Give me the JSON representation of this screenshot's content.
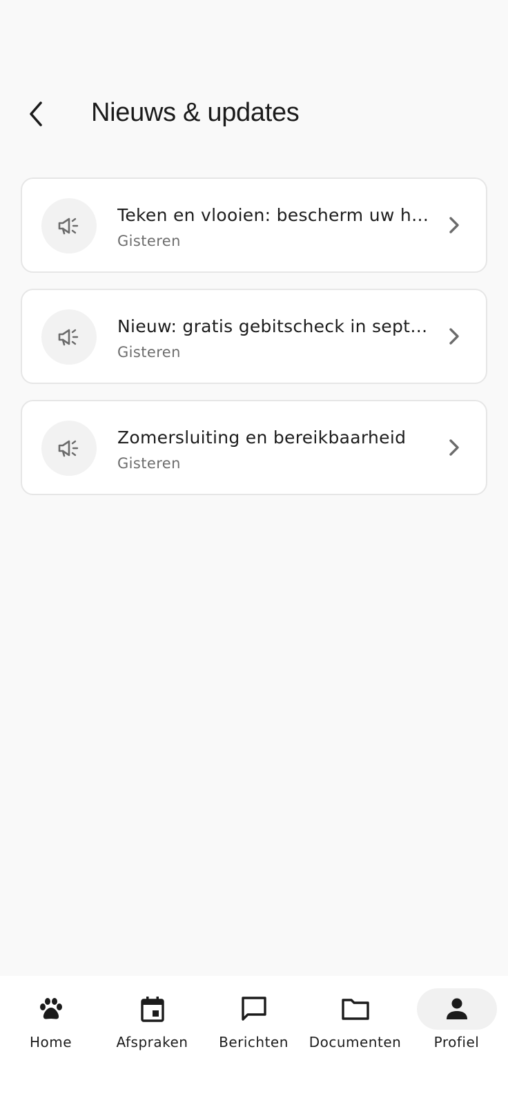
{
  "header": {
    "title": "Nieuws & updates",
    "back_icon": "chevron-left-icon"
  },
  "news": [
    {
      "title": "Teken en vlooien: bescherm uw hui...",
      "date": "Gisteren",
      "icon": "megaphone-icon"
    },
    {
      "title": "Nieuw: gratis gebitscheck in septe...",
      "date": "Gisteren",
      "icon": "megaphone-icon"
    },
    {
      "title": "Zomersluiting en bereikbaarheid",
      "date": "Gisteren",
      "icon": "megaphone-icon"
    }
  ],
  "nav": {
    "items": [
      {
        "label": "Home",
        "icon": "paw-icon"
      },
      {
        "label": "Afspraken",
        "icon": "calendar-icon"
      },
      {
        "label": "Berichten",
        "icon": "chat-icon"
      },
      {
        "label": "Documenten",
        "icon": "folder-icon"
      },
      {
        "label": "Profiel",
        "icon": "person-icon",
        "active": true
      }
    ]
  },
  "colors": {
    "background": "#f9f9f9",
    "card": "#ffffff",
    "icon_circle": "#f2f2f2",
    "muted_text": "#6d6d6d"
  }
}
